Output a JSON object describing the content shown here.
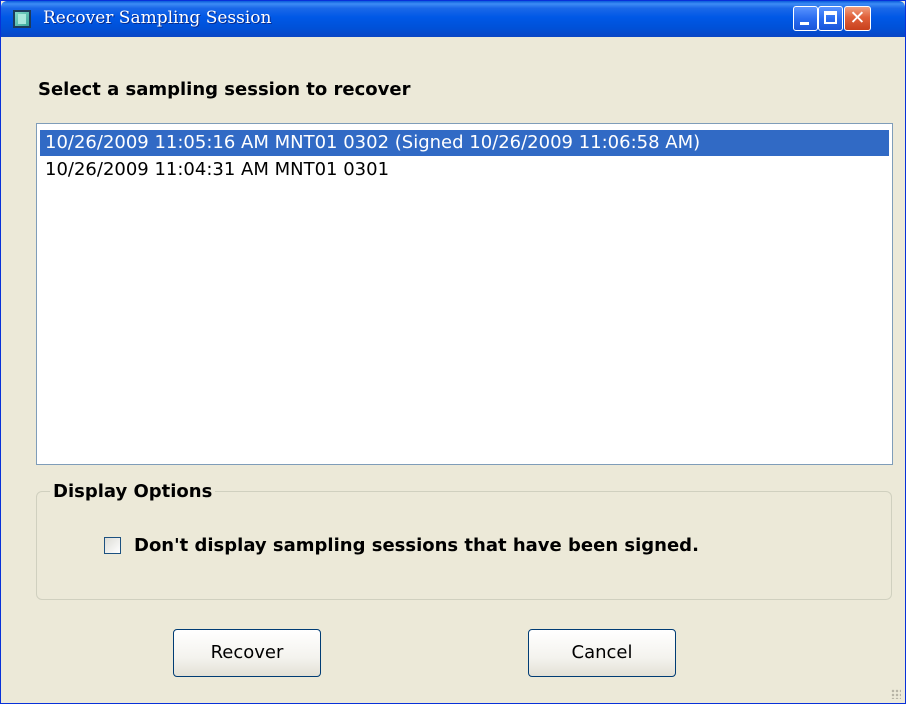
{
  "window": {
    "title": "Recover Sampling Session",
    "titlebar_color": "#0058e6",
    "buttons": [
      "minimize",
      "maximize",
      "close"
    ]
  },
  "prompt": "Select a sampling session to recover",
  "sessions": {
    "items": [
      {
        "label": "10/26/2009 11:05:16 AM MNT01 0302 (Signed 10/26/2009 11:06:58 AM)",
        "selected": true
      },
      {
        "label": "10/26/2009 11:04:31 AM MNT01 0301",
        "selected": false
      }
    ],
    "selection_color": "#316ac5"
  },
  "display_options": {
    "title": "Display Options",
    "hide_signed_label": "Don't display sampling sessions that have been signed.",
    "hide_signed_checked": false
  },
  "actions": {
    "recover_label": "Recover",
    "cancel_label": "Cancel"
  },
  "icons": [
    "app-icon",
    "minimize-icon",
    "maximize-icon",
    "close-icon",
    "size-grip-icon"
  ]
}
